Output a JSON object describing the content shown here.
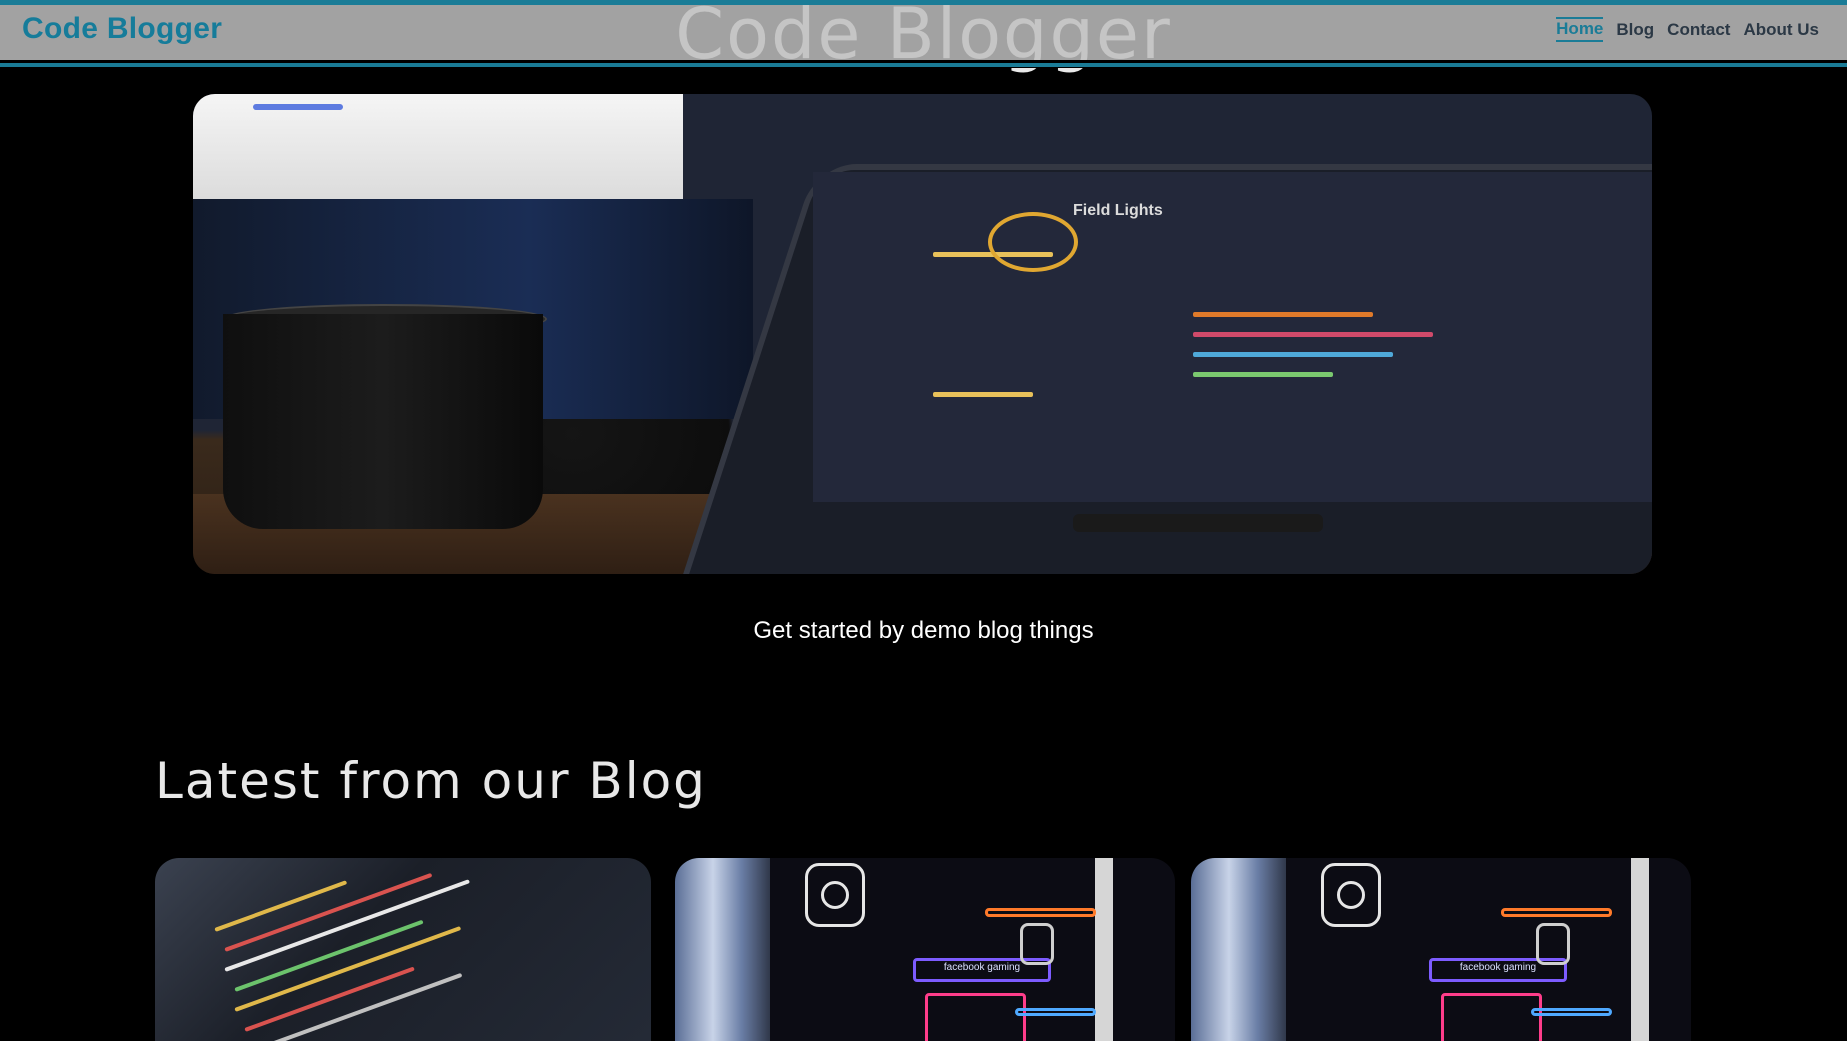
{
  "header": {
    "brand": "Code Blogger",
    "nav": [
      {
        "label": "Home",
        "active": true
      },
      {
        "label": "Blog",
        "active": false
      },
      {
        "label": "Contact",
        "active": false
      },
      {
        "label": "About Us",
        "active": false
      }
    ],
    "accent_color": "#1a7c97"
  },
  "hero": {
    "image_subject": "laptop-with-coffee-mug",
    "screen_text": "Field Lights"
  },
  "tagline": "Get started by demo blog things",
  "blog_section": {
    "title": "Latest from our Blog",
    "cards": [
      {
        "image_subject": "code-editor"
      },
      {
        "image_subject": "neon-arcade",
        "sign_text": "facebook gaming"
      },
      {
        "image_subject": "neon-arcade",
        "sign_text": "facebook gaming"
      }
    ]
  }
}
